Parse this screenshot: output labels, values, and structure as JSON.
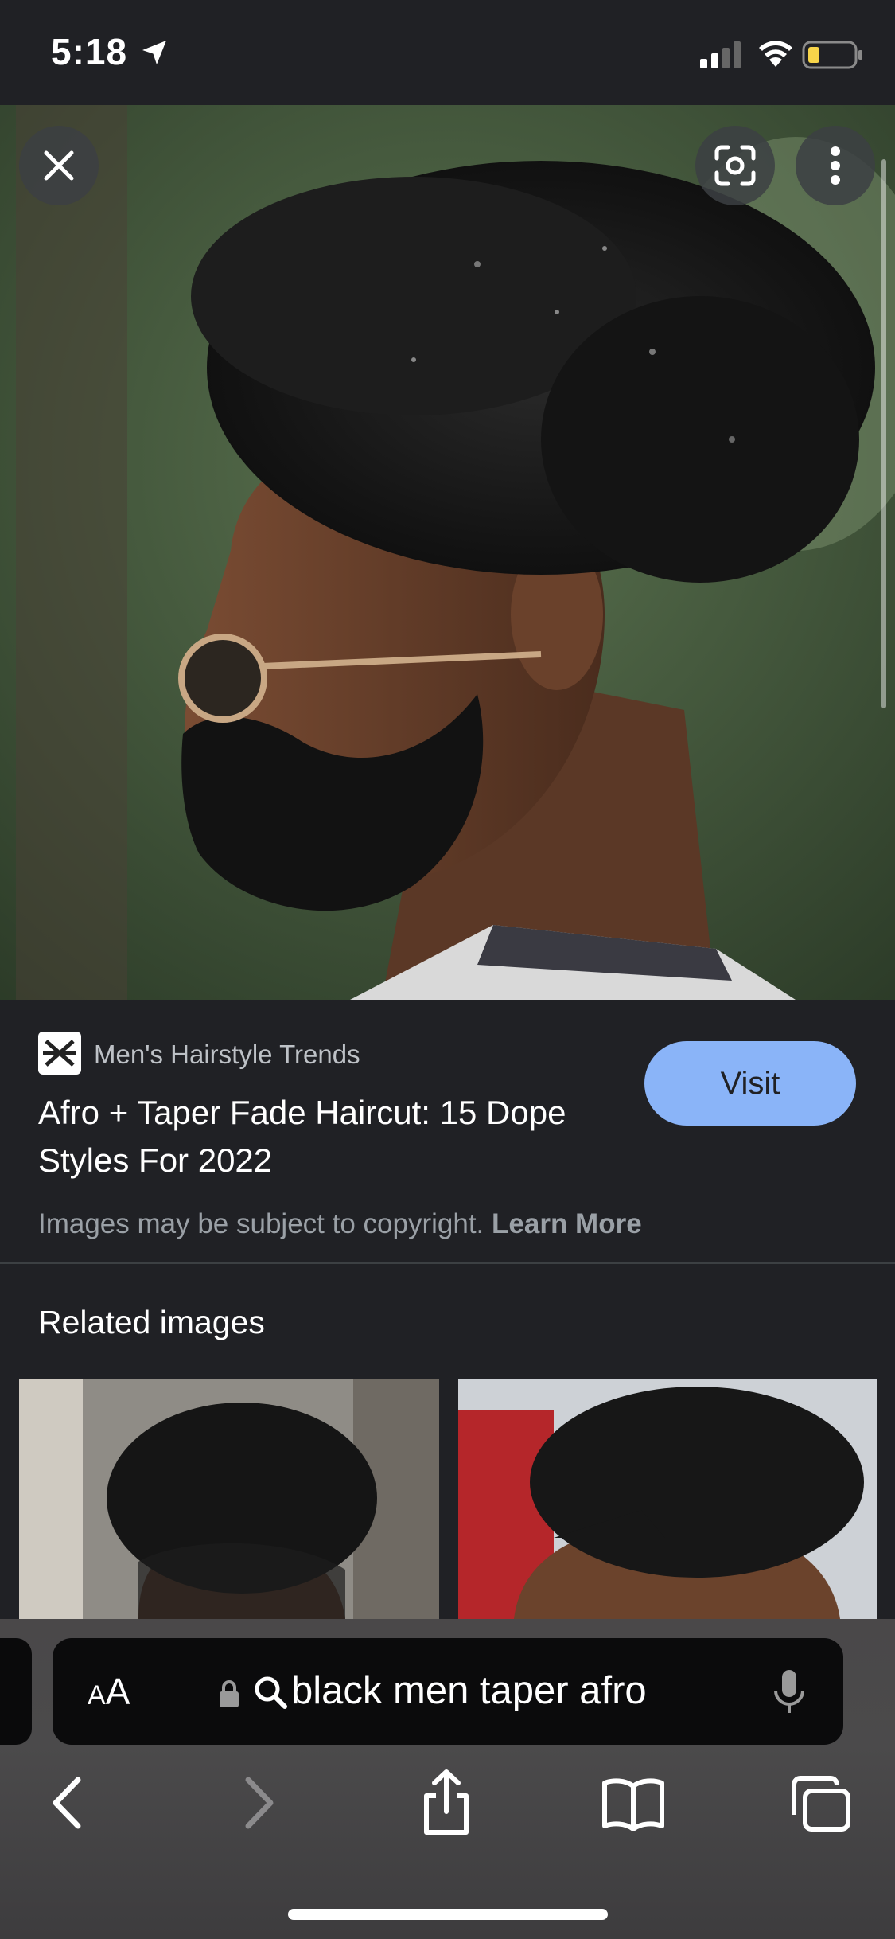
{
  "status_bar": {
    "time": "5:18"
  },
  "image_viewer": {
    "close_label": "Close",
    "lens_label": "Search inside image",
    "more_label": "More options"
  },
  "result": {
    "source": "Men's Hairstyle Trends",
    "title": "Afro + Taper Fade Haircut: 15 Dope Styles For 2022",
    "visit_label": "Visit",
    "copyright_text": "Images may be subject to copyright.",
    "learn_more": "Learn More"
  },
  "related": {
    "heading": "Related images"
  },
  "browser": {
    "aa_small": "A",
    "aa_large": "A",
    "address": "black men taper afro"
  },
  "icons": {
    "close": "close-icon",
    "lens": "google-lens-icon",
    "more": "more-vert-icon",
    "lock": "lock-icon",
    "search": "search-icon",
    "mic": "microphone-icon",
    "back": "chevron-left-icon",
    "forward": "chevron-right-icon",
    "share": "share-icon",
    "bookmarks": "book-icon",
    "tabs": "tabs-icon"
  },
  "colors": {
    "background": "#202125",
    "visit_button": "#8ab4f8",
    "address_bar": "#0b0b0c"
  }
}
